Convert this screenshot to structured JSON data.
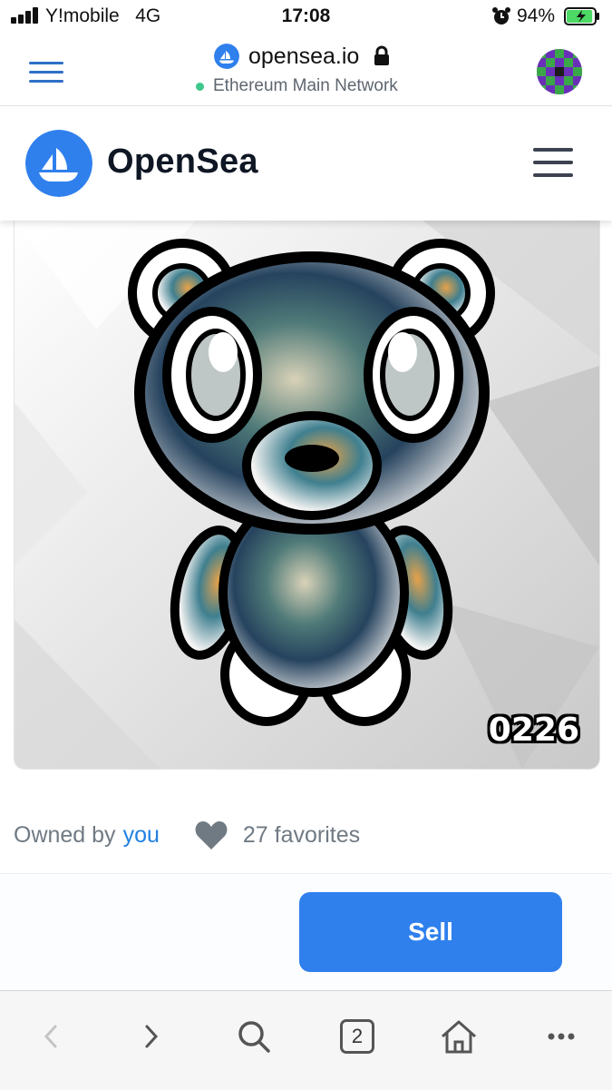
{
  "status_bar": {
    "carrier": "Y!mobile",
    "network_type": "4G",
    "time": "17:08",
    "battery_percent": "94%",
    "battery_level": 0.94
  },
  "browser": {
    "host": "opensea.io",
    "network": "Ethereum Main Network",
    "tab_count": "2"
  },
  "site": {
    "brand": "OpenSea",
    "accent_color": "#2081e2"
  },
  "item": {
    "token_label": "0226",
    "owned_by_label": "Owned by",
    "owner": "you",
    "favorites": "27 favorites"
  },
  "actions": {
    "sell_label": "Sell"
  },
  "icons": {
    "nav_menu": "menu-icon",
    "lock": "lock-icon",
    "site_menu": "hamburger-icon",
    "heart": "heart-icon",
    "toolbar": [
      "back-icon",
      "forward-icon",
      "search-icon",
      "tabs-icon",
      "home-icon",
      "more-icon"
    ]
  }
}
